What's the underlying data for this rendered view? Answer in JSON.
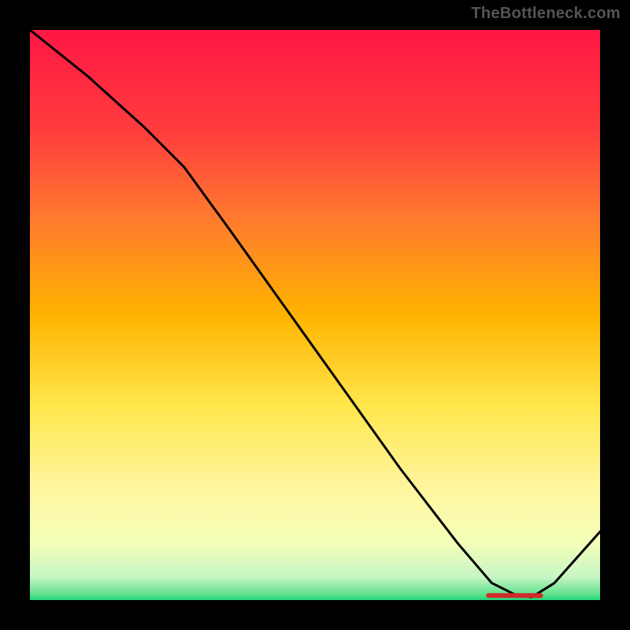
{
  "watermark": "TheBottleneck.com",
  "marker_label": "",
  "colors": {
    "curve": "#000000",
    "marker_bg": "#d02a2a",
    "marker_text": "#d02a2a",
    "frame": "#000000"
  },
  "chart_data": {
    "type": "line",
    "title": "",
    "xlabel": "",
    "ylabel": "",
    "xlim": [
      0,
      100
    ],
    "ylim": [
      0,
      100
    ],
    "comment": "no numeric axis ticks are rendered; values below are visual estimates on a 0-100 normalized scale (x left→right, y bottom→top)",
    "series": [
      {
        "name": "curve",
        "x": [
          0,
          10,
          20,
          27,
          35,
          45,
          55,
          65,
          75,
          81,
          85,
          88,
          92,
          100
        ],
        "y": [
          100,
          92,
          83,
          76,
          65,
          51,
          37,
          23,
          10,
          3,
          1,
          0.5,
          3,
          12
        ]
      }
    ],
    "marker": {
      "x_start": 80,
      "x_end": 90,
      "y": 0.8
    },
    "gradient": [
      {
        "pct": 0,
        "color": "#ff1744"
      },
      {
        "pct": 18,
        "color": "#ff3d3d"
      },
      {
        "pct": 33,
        "color": "#ff7a2e"
      },
      {
        "pct": 50,
        "color": "#ffb300"
      },
      {
        "pct": 66,
        "color": "#ffe74c"
      },
      {
        "pct": 80,
        "color": "#fff59d"
      },
      {
        "pct": 90,
        "color": "#f4ffb8"
      },
      {
        "pct": 96,
        "color": "#c6f6c4"
      },
      {
        "pct": 99,
        "color": "#5fe08b"
      },
      {
        "pct": 100,
        "color": "#1fd67a"
      }
    ]
  }
}
